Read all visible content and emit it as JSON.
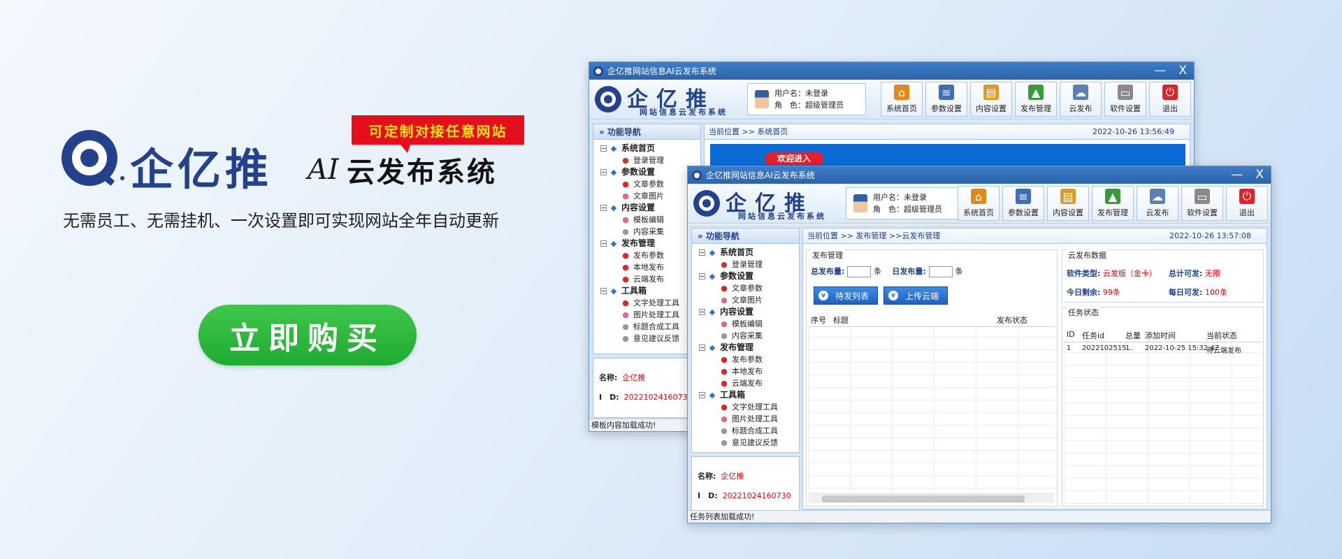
{
  "hero": {
    "brand_name": "企亿推",
    "brand_ai": "AI",
    "brand_title": "云发布系统",
    "badge": "可定制对接任意网站",
    "tagline": "无需员工、无需挂机、一次设置即可实现网站全年自动更新",
    "buy_button": "立即购买"
  },
  "app": {
    "window_title": "企亿推网站信息AI云发布系统",
    "logo_name": "企亿推",
    "logo_sub": "网站信息云发布系统",
    "user_label": "用户名：未登录",
    "role_label": "角　色：超级管理员",
    "toolbar": [
      {
        "label": "系统首页",
        "icon": "home-icon",
        "color": "#e08a1e"
      },
      {
        "label": "参数设置",
        "icon": "list-icon",
        "color": "#3f6fb4"
      },
      {
        "label": "内容设置",
        "icon": "clipboard-icon",
        "color": "#d99b2b"
      },
      {
        "label": "发布管理",
        "icon": "publish-icon",
        "color": "#3a9a3a"
      },
      {
        "label": "云发布",
        "icon": "cloud-icon",
        "color": "#5a7fb5"
      },
      {
        "label": "软件设置",
        "icon": "disk-icon",
        "color": "#8a8a8a"
      },
      {
        "label": "退出",
        "icon": "power-icon",
        "color": "#d9252b"
      }
    ],
    "nav_title": "» 功能导航",
    "nav_groups": [
      {
        "label": "系统首页",
        "color": "#2f72c9",
        "items": [
          {
            "label": "登录管理",
            "color": "#c03b3b"
          }
        ]
      },
      {
        "label": "参数设置",
        "color": "#2f72c9",
        "items": [
          {
            "label": "文章参数",
            "color": "#d9252b"
          },
          {
            "label": "文章图片",
            "color": "#d96c8a"
          }
        ]
      },
      {
        "label": "内容设置",
        "color": "#2f72c9",
        "items": [
          {
            "label": "模板编辑",
            "color": "#d96c8a"
          },
          {
            "label": "内容采集",
            "color": "#999"
          }
        ]
      },
      {
        "label": "发布管理",
        "color": "#2f72c9",
        "items": [
          {
            "label": "发布参数",
            "color": "#d9252b"
          },
          {
            "label": "本地发布",
            "color": "#d9252b"
          },
          {
            "label": "云端发布",
            "color": "#d9252b"
          }
        ]
      },
      {
        "label": "工具箱",
        "color": "#2f72c9",
        "items": [
          {
            "label": "文字处理工具",
            "color": "#d9252b"
          },
          {
            "label": "图片处理工具",
            "color": "#d96c8a"
          },
          {
            "label": "标题合成工具",
            "color": "#999"
          },
          {
            "label": "意见建议反馈",
            "color": "#999"
          }
        ]
      }
    ],
    "name_label": "名称:",
    "name_value": "企亿推",
    "id_label": "I　D:",
    "id_value": "20221024160730"
  },
  "back_window": {
    "crumb_prefix": "当前位置",
    "crumb": ">> 系统首页",
    "datetime": "2022-10-26 13:56:49",
    "welcome": "欢迎进入",
    "status": "模板内容加载成功!"
  },
  "front_window": {
    "crumb_prefix": "当前位置",
    "crumb": ">> 发布管理 >>云发布管理",
    "datetime": "2022-10-26 13:57:08",
    "publish_panel": "发布管理",
    "total_label": "总发布量:",
    "daily_label": "日发布量:",
    "unit": "条",
    "btn_pending": "待发列表",
    "btn_upload": "上传云端",
    "list_headers": [
      "序号",
      "标题",
      "发布状态"
    ],
    "cloud_panel": "云发布数据",
    "soft_type_label": "软件类型:",
    "soft_type_value": "云发版（金卡）",
    "total_avail_label": "总计可发:",
    "total_avail_value": "无限",
    "today_left_label": "今日剩余:",
    "today_left_value": "99条",
    "daily_avail_label": "每日可发:",
    "daily_avail_value": "100条",
    "task_panel": "任务状态",
    "task_headers": [
      "ID",
      "任务id",
      "总量",
      "添加时间",
      "当前状态"
    ],
    "task_rows": [
      [
        "1",
        "2022102515...",
        "1",
        "2022-10-25 15:32:47",
        "待云端发布"
      ]
    ],
    "status": "任务列表加载成功!"
  }
}
